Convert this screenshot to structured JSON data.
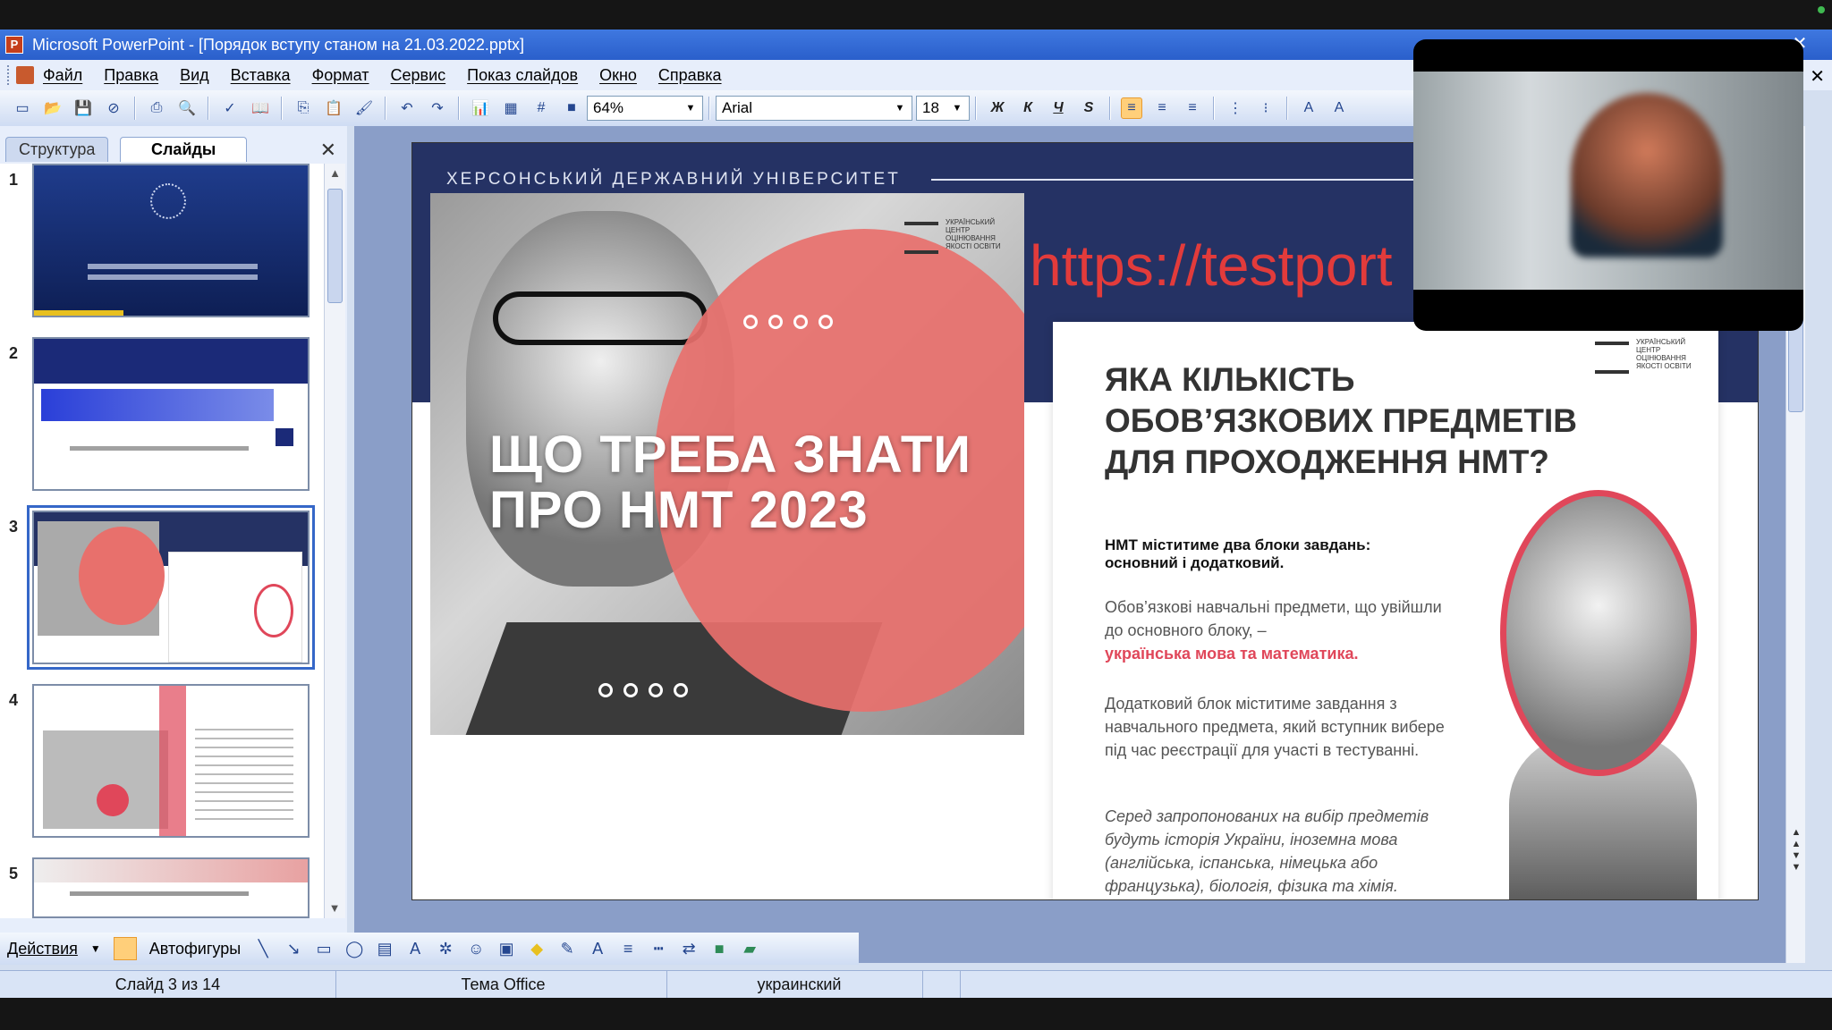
{
  "window": {
    "title": "Microsoft PowerPoint - [Порядок вступу станом на 21.03.2022.pptx]"
  },
  "menu": [
    "Файл",
    "Правка",
    "Вид",
    "Вставка",
    "Формат",
    "Сервис",
    "Показ слайдов",
    "Окно",
    "Справка"
  ],
  "toolbar": {
    "zoom": "64%",
    "font": "Arial",
    "font_size": "18",
    "bold": "Ж",
    "italic": "К",
    "underline": "Ч",
    "shadow": "S"
  },
  "left_pane": {
    "tabs": [
      "Структура",
      "Слайды"
    ],
    "active_tab": "Слайды",
    "slide_numbers": [
      "1",
      "2",
      "3",
      "4",
      "5"
    ],
    "selected_slide": 3
  },
  "slide": {
    "university": "ХЕРСОНСЬКИЙ ДЕРЖАВНИЙ УНІВЕРСИТЕТ",
    "url": "https://testport",
    "hero_title_line1": "ЩО ТРЕБА ЗНАТИ",
    "hero_title_line2": "ПРО НМТ 2023",
    "logo_text": "УКРАЇНСЬКИЙ ЦЕНТР ОЦІНЮВАННЯ ЯКОСТІ ОСВІТИ",
    "panel_heading": "ЯКА КІЛЬКІСТЬ ОБОВ’ЯЗКОВИХ ПРЕДМЕТІВ ДЛЯ ПРОХОДЖЕННЯ НМТ?",
    "panel_p1": "НМТ міститиме два блоки завдань: основний і додатковий.",
    "panel_p2": "Обов’язкові навчальні предмети, що увійшли до основного блоку, –",
    "panel_p2_red": "українська мова та математика.",
    "panel_p3": "Додатковий блок міститиме завдання з навчального предмета, який вступник вибере під час реєстрації для участі в тестуванні.",
    "panel_p4": "Серед запропонованих на вибір предметів будуть історія України, іноземна мова (англійська, іспанська, німецька або французька), біологія, фізика та хімія."
  },
  "draw_toolbar": {
    "actions": "Действия",
    "autoshapes": "Автофигуры"
  },
  "status": {
    "slide_of": "Слайд 3 из 14",
    "theme": "Тема Office",
    "language": "украинский"
  },
  "colors": {
    "title_bar": "#2a5fcb",
    "slide_band": "#253264",
    "accent_red": "#e0475a"
  }
}
